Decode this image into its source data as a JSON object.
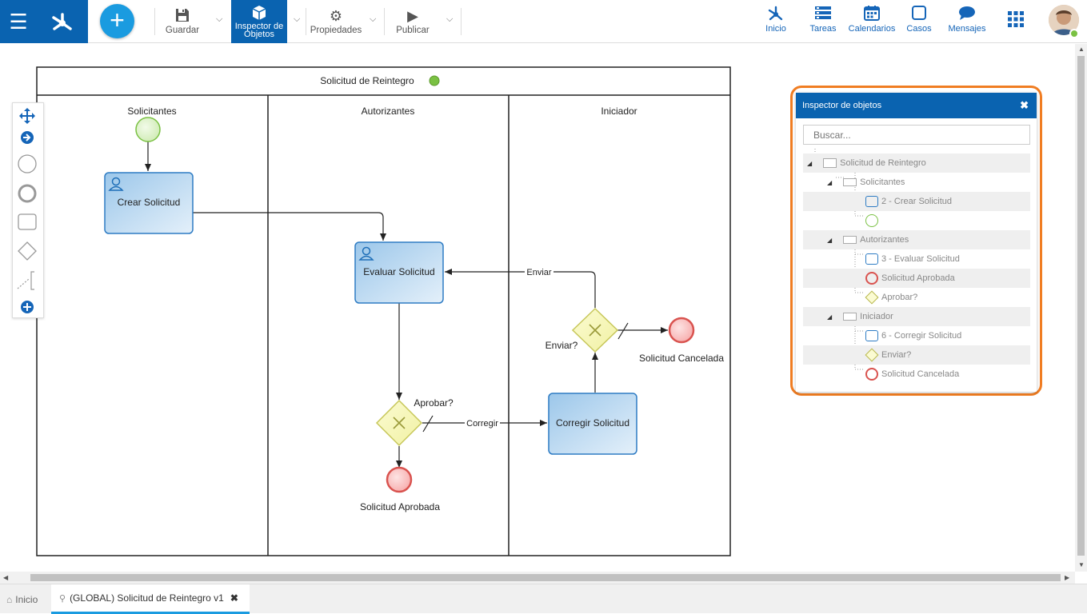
{
  "toolbar": {
    "save_label": "Guardar",
    "inspector_label_1": "Inspector de",
    "inspector_label_2": "Objetos",
    "properties_label": "Propiedades",
    "publish_label": "Publicar"
  },
  "nav": {
    "home_label": "Inicio",
    "tasks_label": "Tareas",
    "calendars_label": "Calendarios",
    "cases_label": "Casos",
    "messages_label": "Mensajes"
  },
  "diagram": {
    "pool_title": "Solicitud de Reintegro",
    "lanes": [
      "Solicitantes",
      "Autorizantes",
      "Iniciador"
    ],
    "task_create": "Crear Solicitud",
    "task_evaluate": "Evaluar Solicitud",
    "task_correct": "Corregir Solicitud",
    "gateway_approve": "Aprobar?",
    "gateway_send": "Enviar?",
    "flow_correct": "Corregir",
    "flow_send": "Enviar",
    "end_approved": "Solicitud Aprobada",
    "end_cancelled": "Solicitud Cancelada"
  },
  "inspector": {
    "title": "Inspector de objetos",
    "search_placeholder": "Buscar...",
    "tree": [
      "Solicitud de Reintegro",
      "Solicitantes",
      "2 - Crear Solicitud",
      "",
      "Autorizantes",
      "3 - Evaluar Solicitud",
      "Solicitud Aprobada",
      "Aprobar?",
      "Iniciador",
      "6 - Corregir Solicitud",
      "Enviar?",
      "Solicitud Cancelada"
    ]
  },
  "tabs": {
    "home_label": "Inicio",
    "process_label": "(GLOBAL) Solicitud de Reintegro v1"
  },
  "colors": {
    "brand": "#0a63b0",
    "accent": "#1a9be0",
    "highlight": "#f07d22",
    "start_event": "#7ac143",
    "end_event": "#d9534f"
  }
}
